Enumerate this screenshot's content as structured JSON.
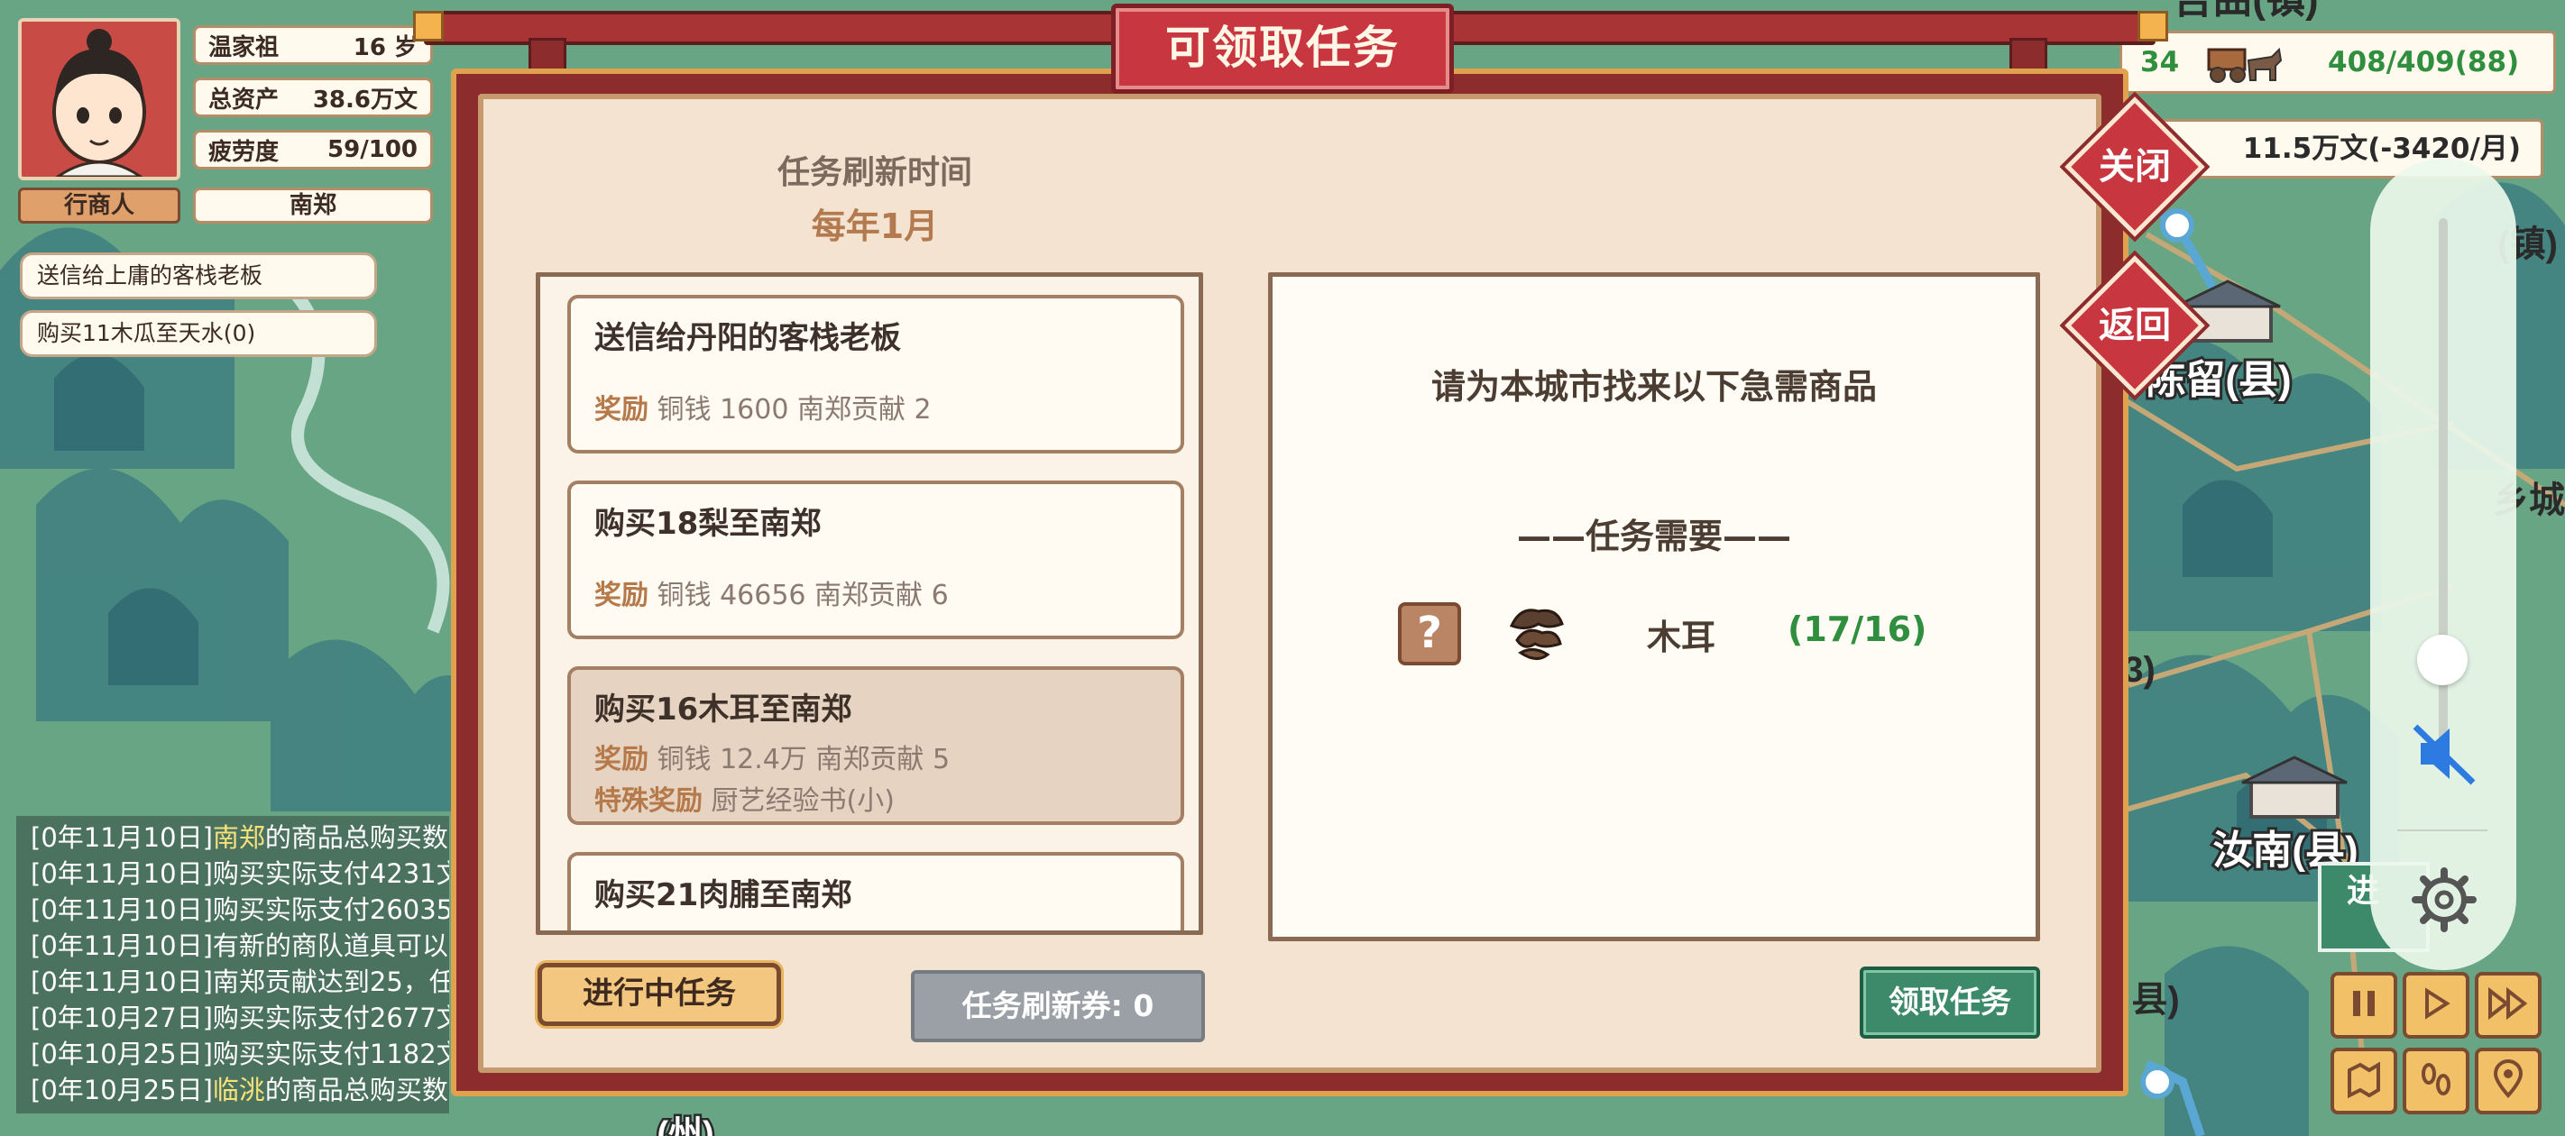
{
  "character": {
    "name": "温家祖",
    "age": "16 岁",
    "assets_label": "总资产",
    "assets_value": "38.6万文",
    "fatigue_label": "疲劳度",
    "fatigue_value": "59/100",
    "role": "行商人",
    "location": "南郑"
  },
  "active_quests": [
    "送信给上庸的客栈老板",
    "购买11木瓜至天水(0)"
  ],
  "status": {
    "caravan_left": "34",
    "caravan_value": "408/409(88)",
    "money": "11.5万文(-3420/月)"
  },
  "map_labels": {
    "top_city": "吉曲(镇)",
    "chenliu": "陈留(县)",
    "runan": "汝南(县)",
    "edge_1": "(镇)",
    "edge_2": "乡城",
    "edge_3": "县)",
    "edge_4": "3)",
    "bottom_city": "(州)",
    "teal_btn": "进"
  },
  "log": [
    {
      "date": "[0年11月10日]",
      "hl": "南郑",
      "text": "的商品总购买数"
    },
    {
      "date": "[0年11月10日]",
      "hl": "",
      "text": "购买实际支付4231文"
    },
    {
      "date": "[0年11月10日]",
      "hl": "",
      "text": "购买实际支付26035"
    },
    {
      "date": "[0年11月10日]",
      "hl": "",
      "text": "有新的商队道具可以"
    },
    {
      "date": "[0年11月10日]",
      "hl": "",
      "text": "南郑贡献达到25，任"
    },
    {
      "date": "[0年10月27日]",
      "hl": "",
      "text": "购买实际支付2677文"
    },
    {
      "date": "[0年10月25日]",
      "hl": "",
      "text": "购买实际支付1182文"
    },
    {
      "date": "[0年10月25日]",
      "hl": "临洮",
      "text": "的商品总购买数"
    }
  ],
  "dialog": {
    "title": "可领取任务",
    "close_label": "关闭",
    "back_label": "返回",
    "refresh_title": "任务刷新时间",
    "refresh_value": "每年1月",
    "tasks": [
      {
        "title": "送信给丹阳的客栈老板",
        "reward_label": "奖励",
        "reward": "铜钱 1600 南郑贡献 2"
      },
      {
        "title": "购买18梨至南郑",
        "reward_label": "奖励",
        "reward": "铜钱 46656 南郑贡献 6"
      },
      {
        "title": "购买16木耳至南郑",
        "reward_label": "奖励",
        "reward": "铜钱 12.4万 南郑贡献 5",
        "special_label": "特殊奖励",
        "special": "厨艺经验书(小)"
      },
      {
        "title": "购买21肉脯至南郑"
      }
    ],
    "detail_head": "请为本城市找来以下急需商品",
    "detail_sub": "——任务需要——",
    "item_name": "木耳",
    "item_count": "(17/16)",
    "qmark": "?",
    "btn_in_progress": "进行中任务",
    "btn_ticket": "任务刷新券: 0",
    "btn_accept": "领取任务"
  },
  "colors": {
    "dialog_red": "#c8373f",
    "accent_green": "#2f8f3e",
    "reward_brown": "#b5794a"
  },
  "icons": [
    "mute-icon",
    "settings-icon",
    "pause-icon",
    "play-icon",
    "fast-forward-icon",
    "map-icon",
    "footprints-icon",
    "location-pin-icon",
    "cart-icon",
    "mushroom-icon"
  ]
}
